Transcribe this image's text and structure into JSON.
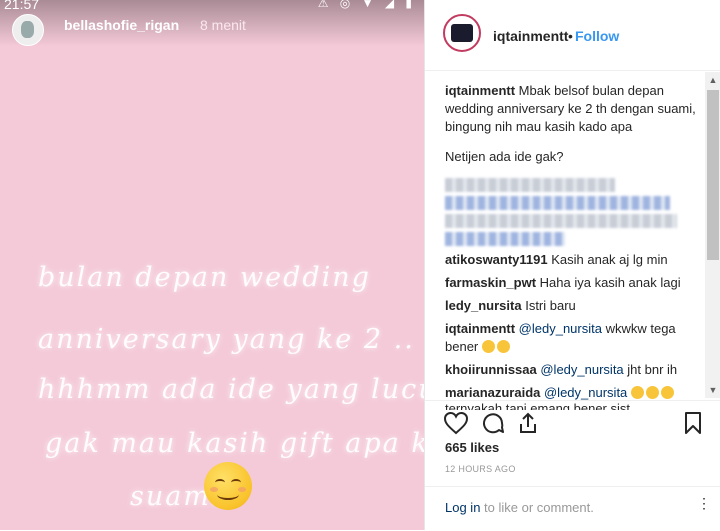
{
  "story": {
    "status_time": "21:57",
    "status_icons": "⚠ ◎ ▼ ◢ ▮",
    "username": "bellashofie_rigan",
    "time_ago": "8 menit",
    "handwritten_lines": [
      "bulan depan wedding",
      "anniversary yang ke 2 ..",
      "hhhmm ada ide yang lucu",
      "gak mau kasih gift apa ke",
      "suami"
    ]
  },
  "post": {
    "username": "iqtainmentt",
    "dot": "•",
    "follow_label": "Follow",
    "caption_user": "iqtainmentt",
    "caption_text": " Mbak belsof bulan depan wedding anniversary ke 2 th dengan suami, bingung nih mau kasih kado apa",
    "caption_question": "Netijen ada ide gak?",
    "comments": [
      {
        "user": "atikoswanty1191",
        "mention": "",
        "text": " Kasih anak aj lg min",
        "emoji_count": 0
      },
      {
        "user": "farmaskin_pwt",
        "mention": "",
        "text": " Haha iya kasih anak lagi",
        "emoji_count": 0
      },
      {
        "user": "ledy_nursita",
        "mention": "",
        "text": " Istri baru",
        "emoji_count": 0
      },
      {
        "user": "iqtainmentt",
        "mention": " @ledy_nursita",
        "text": " wkwkw tega bener ",
        "emoji_count": 2
      },
      {
        "user": "khoiirunnissaa",
        "mention": " @ledy_nursita",
        "text": " jht bnr ih",
        "emoji_count": 0
      },
      {
        "user": "marianazuraida",
        "mention": " @ledy_nursita",
        "text": " ",
        "emoji_count": 3
      },
      {
        "user": "",
        "mention": "",
        "text": "ternyakah tapi emang bener sist",
        "emoji_count": 0
      }
    ],
    "likes": "665 likes",
    "time_ago": "12 HOURS AGO",
    "login_link": "Log in",
    "login_rest": " to like or comment.",
    "kebab": "⋮"
  },
  "icons": [
    "heart-icon",
    "comment-icon",
    "share-icon",
    "bookmark-icon",
    "scroll-up-icon",
    "scroll-down-icon"
  ],
  "colors": {
    "story_bg": "#f4c9d8",
    "link_blue": "#3897f0",
    "mention_blue": "#003569"
  }
}
